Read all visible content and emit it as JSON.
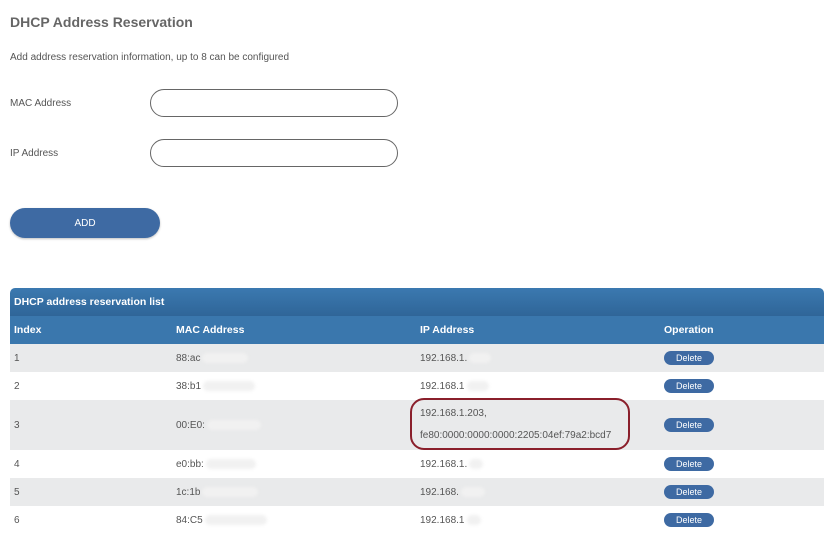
{
  "page": {
    "title": "DHCP Address Reservation",
    "subtitle": "Add address reservation information, up to 8 can be configured"
  },
  "form": {
    "mac_label": "MAC Address",
    "mac_value": "",
    "ip_label": "IP Address",
    "ip_value": "",
    "add_label": "ADD"
  },
  "table": {
    "caption": "DHCP address reservation list",
    "columns": {
      "index": "Index",
      "mac": "MAC Address",
      "ip": "IP Address",
      "operation": "Operation"
    },
    "rows": [
      {
        "index": "1",
        "mac": "88:ac",
        "ip": "192.168.1.",
        "op": "Delete"
      },
      {
        "index": "2",
        "mac": "38:b1",
        "ip": "192.168.1",
        "op": "Delete"
      },
      {
        "index": "3",
        "mac": "00:E0:",
        "ip": "192.168.1.203,",
        "ip2": "fe80:0000:0000:0000:2205:04ef:79a2:bcd7",
        "op": "Delete"
      },
      {
        "index": "4",
        "mac": "e0:bb:",
        "ip": "192.168.1.",
        "op": "Delete"
      },
      {
        "index": "5",
        "mac": "1c:1b",
        "ip": "192.168.",
        "op": "Delete"
      },
      {
        "index": "6",
        "mac": "84:C5",
        "ip": "192.168.1",
        "op": "Delete"
      }
    ]
  },
  "colors": {
    "accent": "#3e6aa3",
    "header": "#3a77ad",
    "highlight": "#8a1f2b"
  }
}
